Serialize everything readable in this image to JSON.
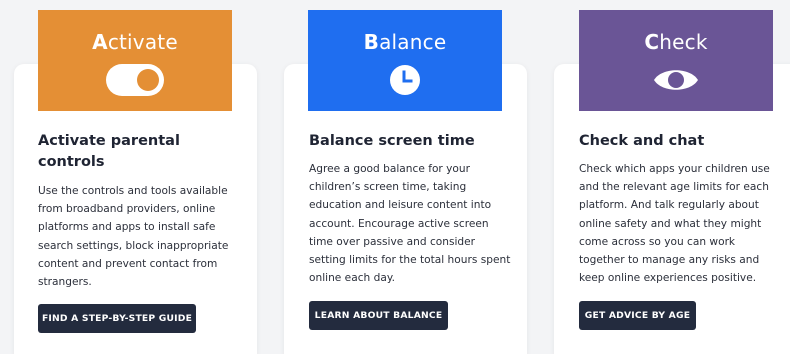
{
  "colors": {
    "activate": "#e48f35",
    "balance": "#1f6ef0",
    "check": "#6a5596",
    "button": "#232b3e"
  },
  "cards": [
    {
      "tile_initial": "A",
      "tile_rest": "ctivate",
      "icon": "toggle-switch-icon",
      "heading": "Activate parental controls",
      "body": "Use the controls and tools available from broadband providers, online platforms and apps to install safe search settings, block inappropriate content and prevent contact from strangers.",
      "button": "FIND A STEP-BY-STEP GUIDE"
    },
    {
      "tile_initial": "B",
      "tile_rest": "alance",
      "icon": "clock-icon",
      "heading": "Balance screen time",
      "body": "Agree a good balance for your children’s screen time, taking education and leisure content into account. Encourage active screen time over passive and consider setting limits for the total hours spent online each day.",
      "button": "LEARN ABOUT BALANCE"
    },
    {
      "tile_initial": "C",
      "tile_rest": "heck",
      "icon": "eye-icon",
      "heading": "Check and chat",
      "body": "Check which apps your children use and the relevant age limits for each platform. And talk regularly about online safety and what they might come across so you can work together to manage any risks and keep online experiences positive.",
      "button": "GET ADVICE BY AGE"
    }
  ]
}
